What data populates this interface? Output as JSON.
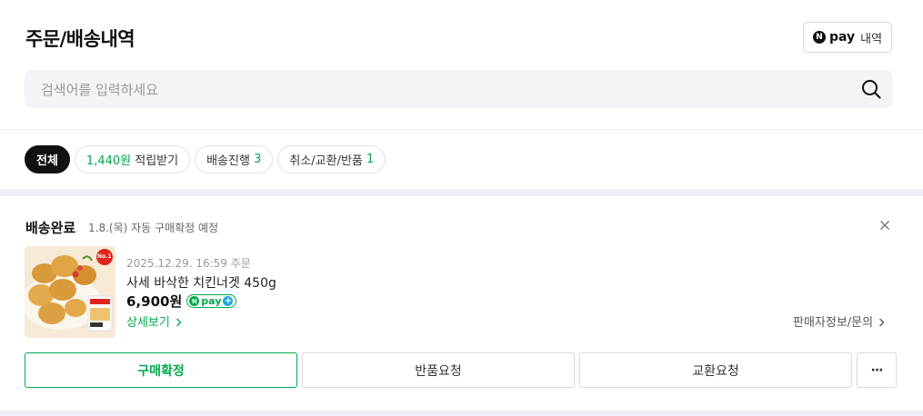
{
  "header": {
    "title": "주문/배송내역",
    "npay_button": {
      "logo": "N",
      "brand": "pay",
      "suffix": "내역"
    },
    "search_placeholder": "검색어를 입력하세요"
  },
  "filters": [
    {
      "label": "전체",
      "count": "",
      "active": true
    },
    {
      "amount": "1,440원",
      "label": "적립받기"
    },
    {
      "label": "배송진행",
      "count": "3"
    },
    {
      "label": "취소/교환/반품",
      "count": "1"
    }
  ],
  "order": {
    "status": "배송완료",
    "sub_status": "1.8.(목) 자동 구매확정 예정",
    "order_date": "2025.12.29. 16:59 주문",
    "product_name": "사세 바삭한 치킨너겟 450g",
    "price": "6,900원",
    "npay_badge": {
      "logo": "N",
      "brand": "pay",
      "plus": "+"
    },
    "detail_link": "상세보기",
    "seller_link": "판매자정보/문의",
    "thumbnail_badge": "No.1"
  },
  "actions": {
    "confirm": "구매확정",
    "return": "반품요청",
    "exchange": "교환요청",
    "more": "···"
  },
  "colors": {
    "accent": "#03a94d",
    "text": "#222222",
    "band": "#eef0f3"
  }
}
